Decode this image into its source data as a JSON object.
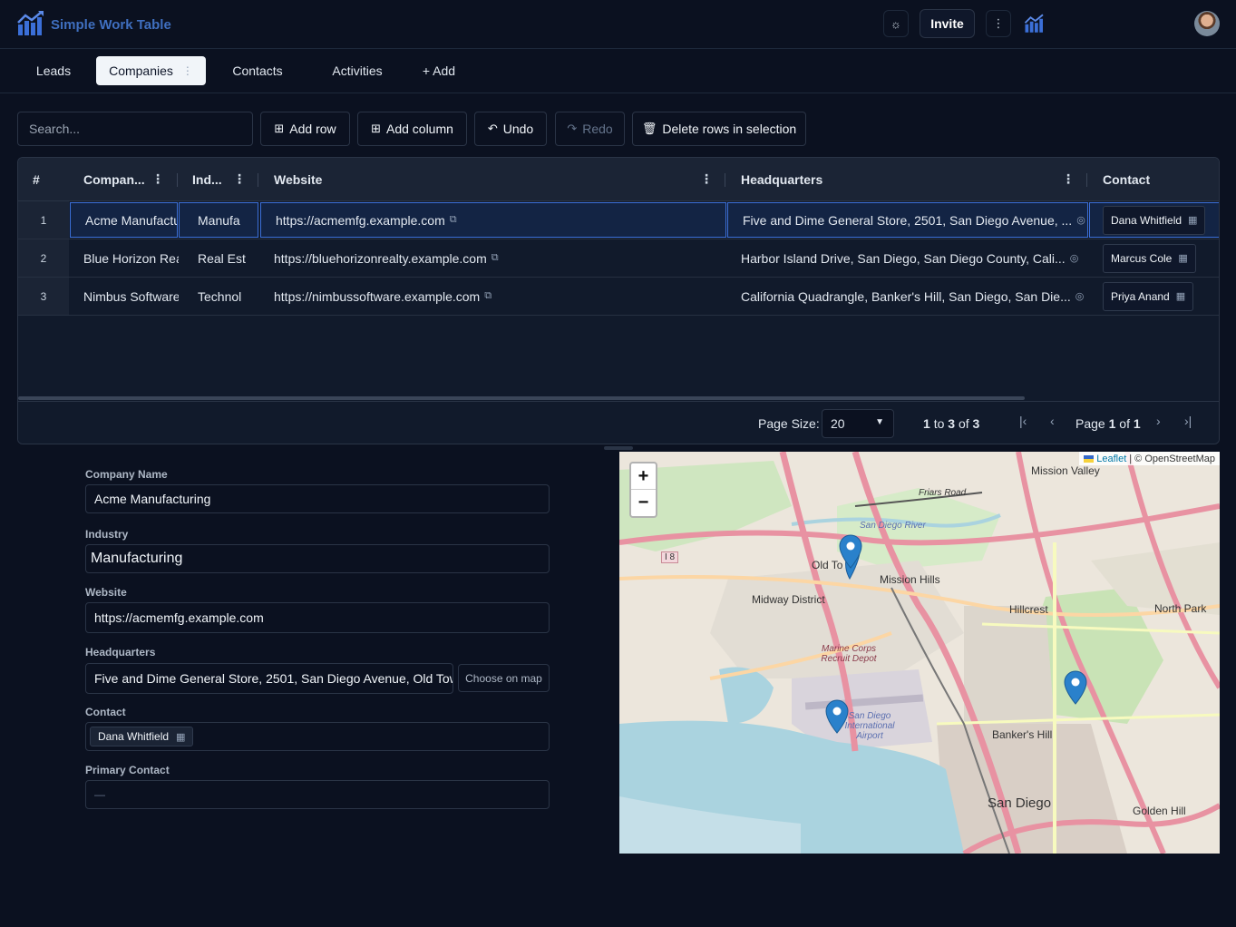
{
  "app": {
    "title": "Simple Work Table"
  },
  "header": {
    "invite_label": "Invite",
    "theme_icon": "sun-icon",
    "menu_icon": "vertical-dots-icon"
  },
  "tabs": [
    {
      "label": "Leads",
      "active": false
    },
    {
      "label": "Companies",
      "active": true
    },
    {
      "label": "Contacts",
      "active": false
    },
    {
      "label": "Activities",
      "active": false
    },
    {
      "label": "+ Add",
      "active": false
    }
  ],
  "toolbar": {
    "search_placeholder": "Search...",
    "add_row": "Add row",
    "add_column": "Add column",
    "undo": "Undo",
    "redo": "Redo",
    "delete_rows": "Delete rows in selection"
  },
  "grid": {
    "columns": [
      "#",
      "Compan...",
      "Ind...",
      "Website",
      "Headquarters",
      "Contact"
    ],
    "rows": [
      {
        "num": "1",
        "company": "Acme Manufactu",
        "industry": "Manufa",
        "website": "https://acmemfg.example.com",
        "headquarters": "Five and Dime General Store, 2501, San Diego Avenue, ...",
        "contact": "Dana Whitfield"
      },
      {
        "num": "2",
        "company": "Blue Horizon Rea",
        "industry": "Real Est",
        "website": "https://bluehorizonrealty.example.com",
        "headquarters": "Harbor Island Drive, San Diego, San Diego County, Cali...",
        "contact": "Marcus Cole"
      },
      {
        "num": "3",
        "company": "Nimbus Software",
        "industry": "Technol",
        "website": "https://nimbussoftware.example.com",
        "headquarters": "California Quadrangle, Banker's Hill, San Diego, San Die...",
        "contact": "Priya Anand"
      }
    ],
    "footer": {
      "page_size_label": "Page Size:",
      "page_size": "20",
      "range_start": "1",
      "range_to": "to",
      "range_end": "3",
      "range_of": "of",
      "total": "3",
      "page_word": "Page",
      "page_current": "1",
      "page_of": "of",
      "page_total": "1"
    }
  },
  "form": {
    "company_name_label": "Company Name",
    "company_name": "Acme Manufacturing",
    "industry_label": "Industry",
    "industry": "Manufacturing",
    "website_label": "Website",
    "website": "https://acmemfg.example.com",
    "headquarters_label": "Headquarters",
    "headquarters": "Five and Dime General Store, 2501, San Diego Avenue, Old Tow",
    "choose_on_map": "Choose on map",
    "contact_label": "Contact",
    "contact": "Dana Whitfield",
    "primary_contact_label": "Primary Contact",
    "primary_contact": "—"
  },
  "map": {
    "zoom_in": "+",
    "zoom_out": "−",
    "attribution_link": "Leaflet",
    "attribution_text": "| © OpenStreetMap",
    "labels": {
      "mission_valley": "Mission Valley",
      "friars_road": "Friars Road",
      "san_diego_river": "San Diego River",
      "old_town": "Old To",
      "mission_hills": "Mission Hills",
      "midway": "Midway District",
      "hillcrest": "Hillcrest",
      "north_park": "North Park",
      "marine_corps": "Marine Corps Recruit Depot",
      "airport": "San Diego International Airport",
      "bankers_hill": "Banker's Hill",
      "san_diego": "San Diego",
      "golden_hill": "Golden Hill",
      "i8": "I 8"
    }
  }
}
